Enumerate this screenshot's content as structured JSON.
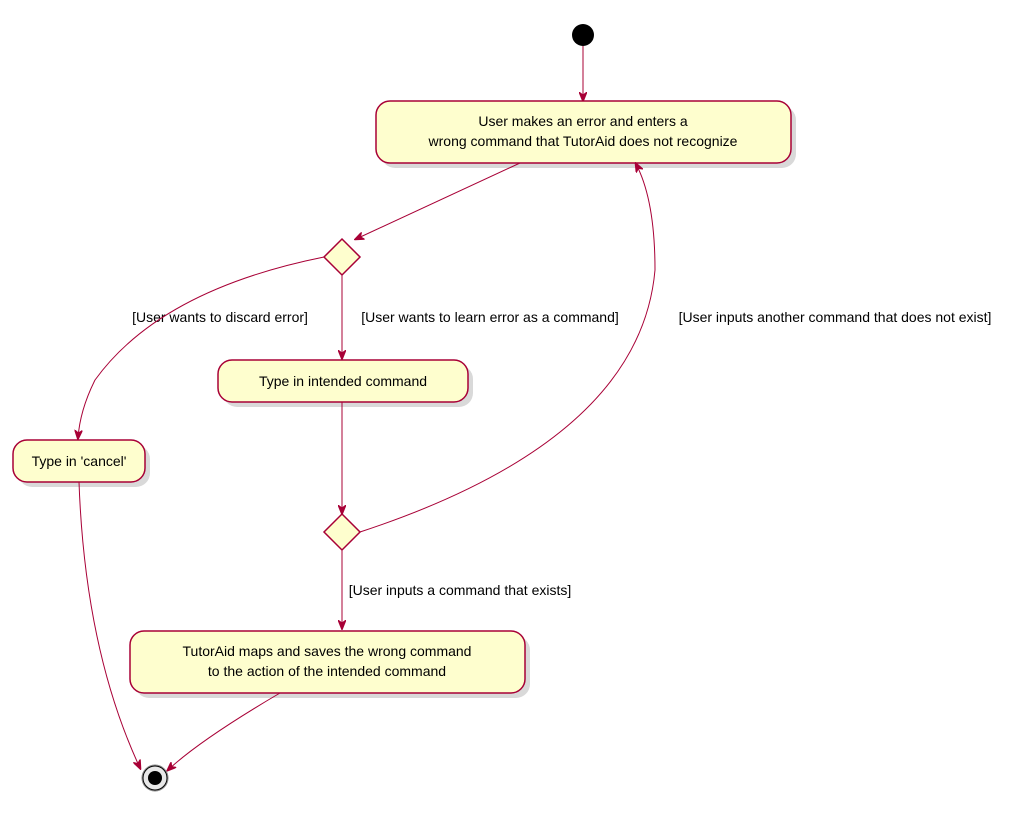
{
  "chart_data": {
    "type": "activity-diagram",
    "title": "",
    "nodes": [
      {
        "id": "start",
        "type": "initial"
      },
      {
        "id": "error",
        "type": "activity",
        "label": "User makes an error and enters a\nwrong command that TutorAid does not recognize"
      },
      {
        "id": "d1",
        "type": "decision"
      },
      {
        "id": "cancel",
        "type": "activity",
        "label": "Type in 'cancel'"
      },
      {
        "id": "intended",
        "type": "activity",
        "label": "Type in intended command"
      },
      {
        "id": "d2",
        "type": "decision"
      },
      {
        "id": "map",
        "type": "activity",
        "label": "TutorAid maps and saves the wrong command\nto the action of the intended command"
      },
      {
        "id": "end",
        "type": "final"
      }
    ],
    "edges": [
      {
        "from": "start",
        "to": "error"
      },
      {
        "from": "error",
        "to": "d1"
      },
      {
        "from": "d1",
        "to": "cancel",
        "guard": "[User wants to discard error]"
      },
      {
        "from": "d1",
        "to": "intended",
        "guard": "[User wants to learn error as a command]"
      },
      {
        "from": "intended",
        "to": "d2"
      },
      {
        "from": "d2",
        "to": "map",
        "guard": "[User inputs a command that exists]"
      },
      {
        "from": "d2",
        "to": "error",
        "guard": "[User inputs another command that does not exist]"
      },
      {
        "from": "cancel",
        "to": "end"
      },
      {
        "from": "map",
        "to": "end"
      }
    ]
  },
  "labels": {
    "node_error_l1": "User makes an error and enters a",
    "node_error_l2": "wrong command that TutorAid does not recognize",
    "node_cancel": "Type in 'cancel'",
    "node_intended": "Type in intended command",
    "node_map_l1": "TutorAid maps and saves the wrong command",
    "node_map_l2": "to the action of the intended command",
    "guard_discard": "[User wants to discard error]",
    "guard_learn": "[User wants to learn error as a command]",
    "guard_exists": "[User inputs a command that exists]",
    "guard_notexist": "[User inputs another command that does not exist]"
  }
}
